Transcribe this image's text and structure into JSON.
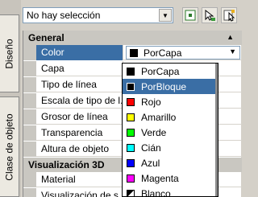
{
  "tabs": {
    "design": "Diseño",
    "object_class": "Clase de objeto"
  },
  "toolbar": {
    "selection_value": "No hay selección"
  },
  "categories": {
    "general": "General",
    "visualization3d": "Visualización 3D"
  },
  "general_rows": [
    {
      "label": "Color",
      "value": "PorCapa"
    },
    {
      "label": "Capa",
      "value": ""
    },
    {
      "label": "Tipo de línea",
      "value": ""
    },
    {
      "label": "Escala de tipo de l...",
      "value": ""
    },
    {
      "label": "Grosor de línea",
      "value": ""
    },
    {
      "label": "Transparencia",
      "value": ""
    },
    {
      "label": "Altura de objeto",
      "value": ""
    }
  ],
  "vis3d_rows": [
    {
      "label": "Material"
    },
    {
      "label": "Visualización de s"
    }
  ],
  "color_options": [
    {
      "label": "PorCapa",
      "color": "#000000"
    },
    {
      "label": "PorBloque",
      "color": "#000000"
    },
    {
      "label": "Rojo",
      "color": "#ff0000"
    },
    {
      "label": "Amarillo",
      "color": "#ffff00"
    },
    {
      "label": "Verde",
      "color": "#00ff00"
    },
    {
      "label": "Cián",
      "color": "#00ffff"
    },
    {
      "label": "Azul",
      "color": "#0000ff"
    },
    {
      "label": "Magenta",
      "color": "#ff00ff"
    },
    {
      "label": "Blanco",
      "color": "#ffffff"
    }
  ],
  "highlighted_option": "PorBloque",
  "colors": {
    "selection": "#3a6ea5",
    "category_bg": "#c9c7c1"
  }
}
